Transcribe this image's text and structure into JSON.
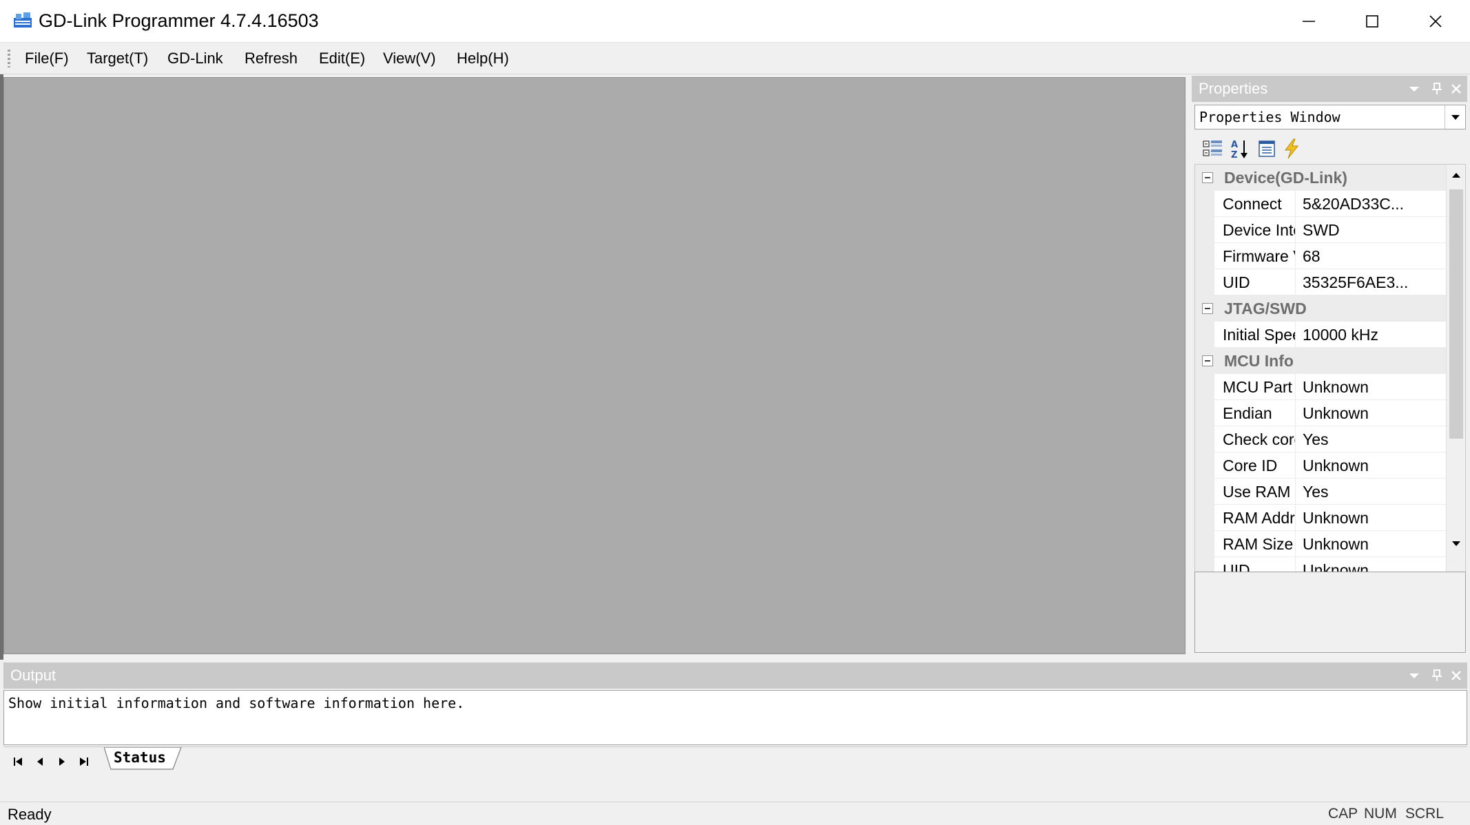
{
  "window": {
    "title": "GD-Link Programmer 4.7.4.16503",
    "controls": [
      "minimize",
      "maximize",
      "close"
    ]
  },
  "menu": {
    "items": [
      "File(F)",
      "Target(T)",
      "GD-Link",
      "Refresh",
      "Edit(E)",
      "View(V)",
      "Help(H)"
    ]
  },
  "properties": {
    "title": "Properties",
    "selector_value": "Properties Window",
    "toolbar_icons": [
      "categorized-icon",
      "alphabetical-sort-icon",
      "property-pages-icon",
      "events-icon"
    ],
    "categories": [
      {
        "name": "Device(GD-Link)",
        "rows": [
          {
            "name": "Connect",
            "value": "5&20AD33C..."
          },
          {
            "name": "Device Inter...",
            "value": "SWD"
          },
          {
            "name": "Firmware Ve...",
            "value": "68"
          },
          {
            "name": "UID",
            "value": "35325F6AE3..."
          }
        ]
      },
      {
        "name": "JTAG/SWD",
        "rows": [
          {
            "name": "Initial Speed",
            "value": "10000 kHz"
          }
        ]
      },
      {
        "name": "MCU Info",
        "rows": [
          {
            "name": "MCU Part No.",
            "value": "Unknown"
          },
          {
            "name": "Endian",
            "value": "Unknown"
          },
          {
            "name": "Check core ID",
            "value": "Yes"
          },
          {
            "name": "Core ID",
            "value": "Unknown"
          },
          {
            "name": "Use RAM",
            "value": "Yes"
          },
          {
            "name": "RAM Address",
            "value": "Unknown"
          },
          {
            "name": "RAM Size",
            "value": "Unknown"
          },
          {
            "name": "UID",
            "value": "Unknown"
          }
        ]
      }
    ]
  },
  "output": {
    "title": "Output",
    "text": "Show initial information and software information here.",
    "tab_label": "Status"
  },
  "statusbar": {
    "text": "Ready",
    "indicators": [
      "CAP",
      "NUM",
      "SCRL"
    ]
  }
}
